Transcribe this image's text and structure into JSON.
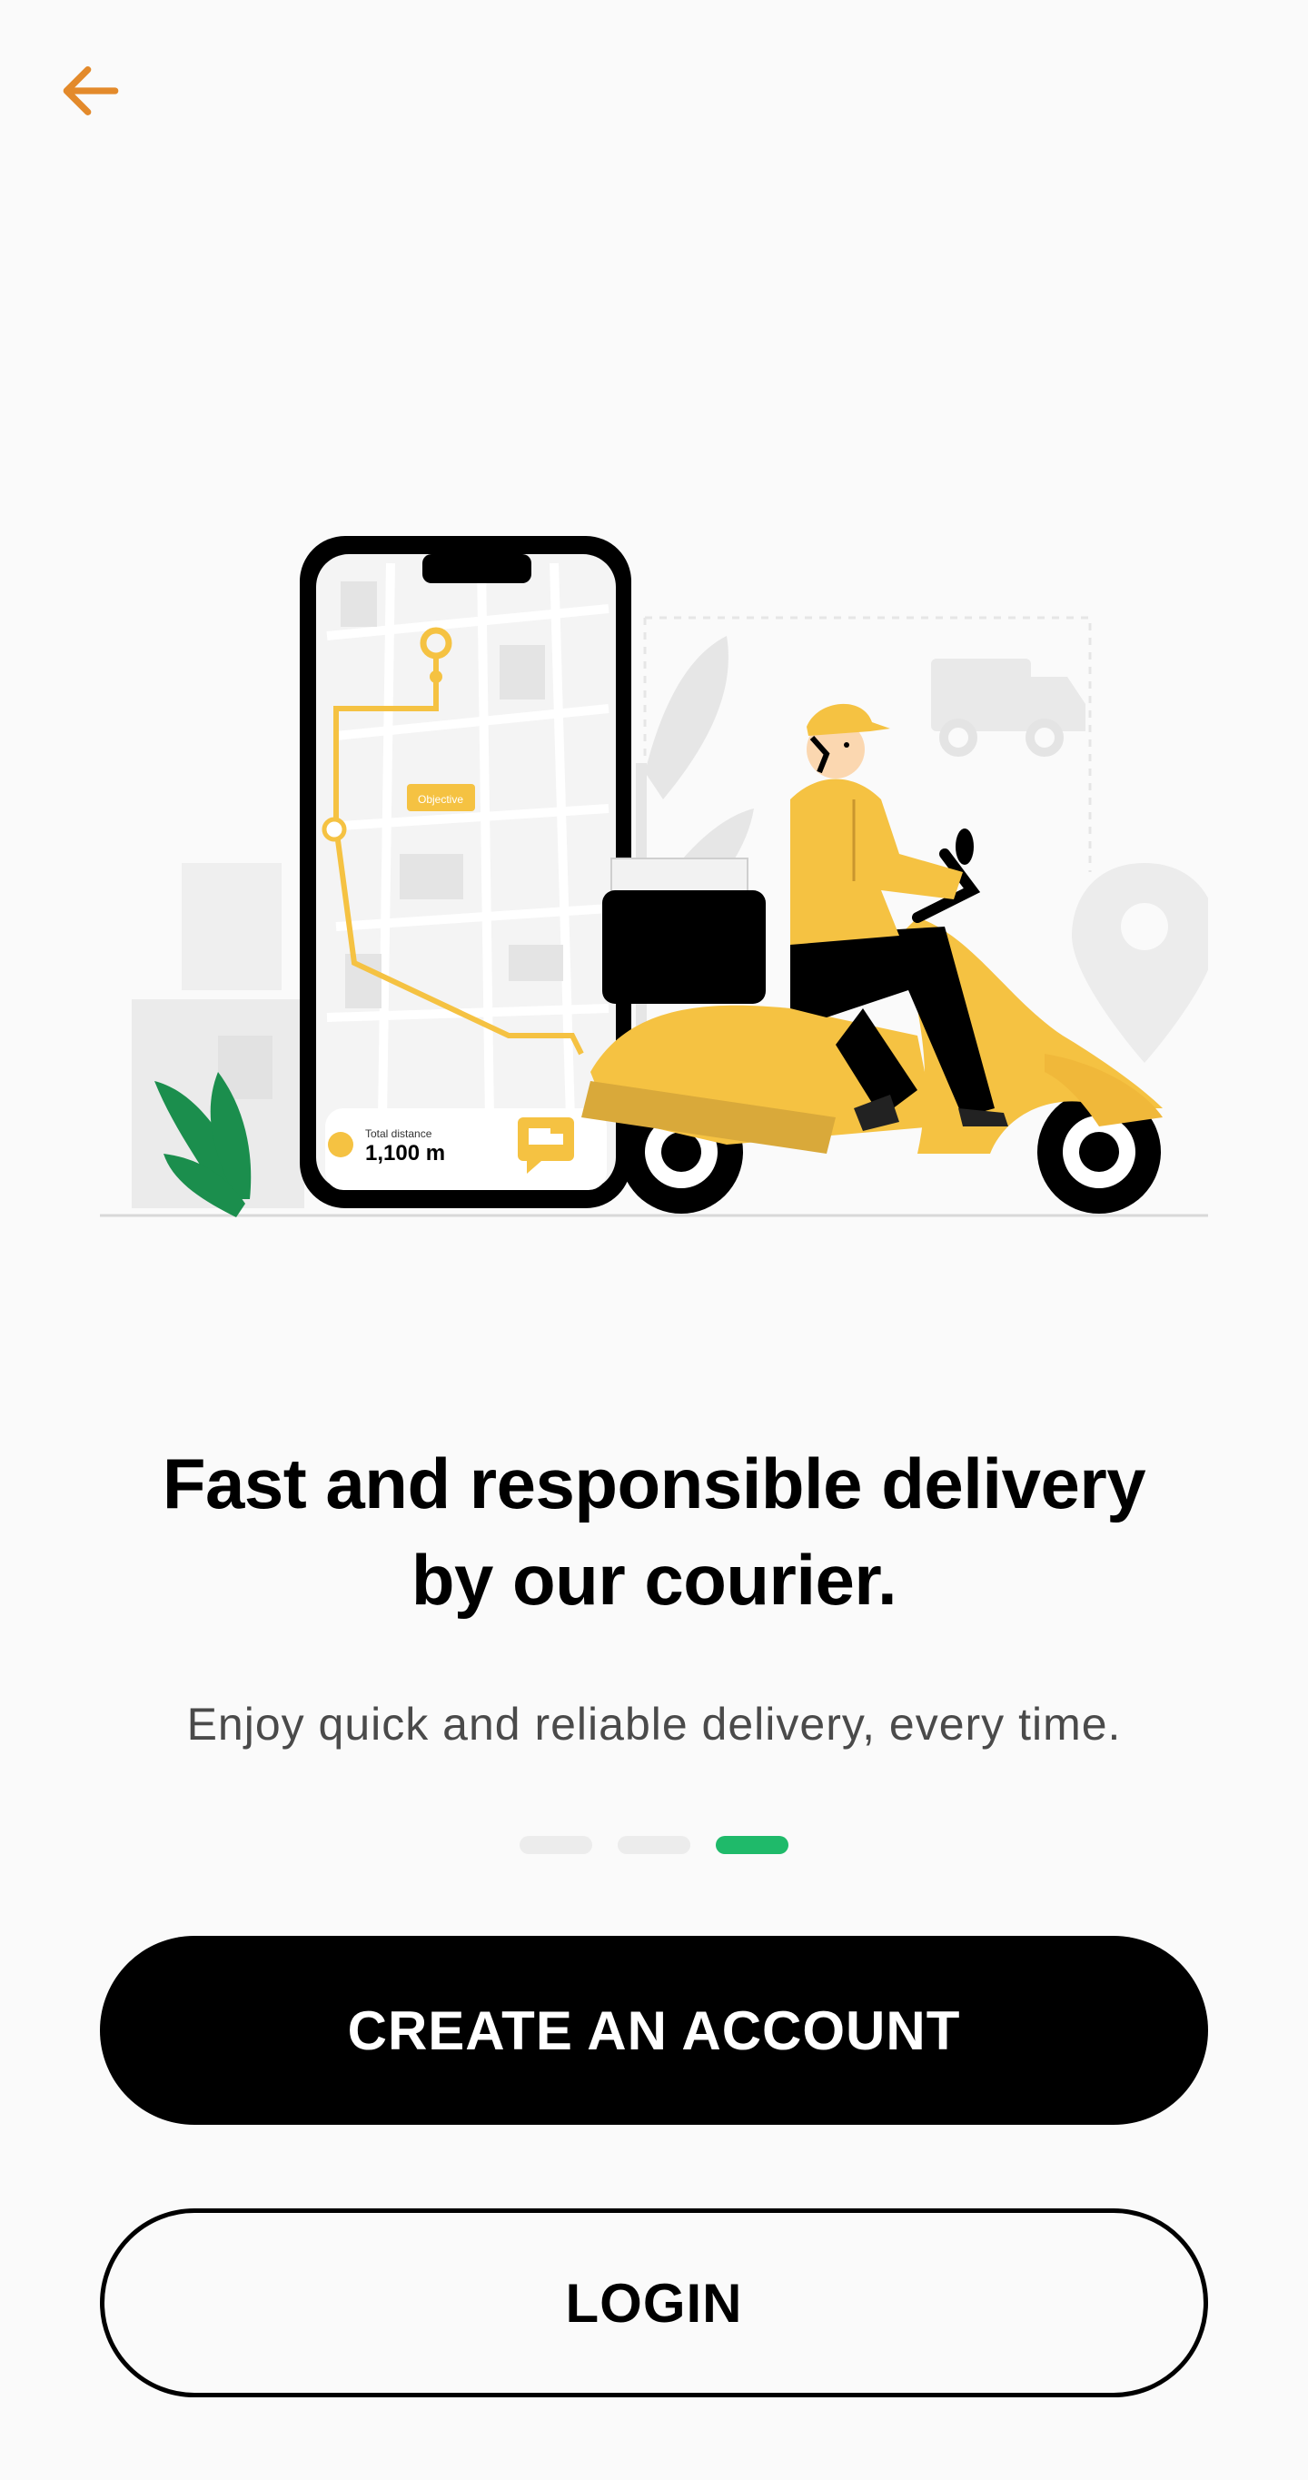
{
  "header": {
    "back_icon": "arrow-left-icon",
    "accent_color": "#e38a2b"
  },
  "illustration": {
    "phone_card": {
      "label": "Total distance",
      "value": "1,100 m",
      "pin_label": "Objective"
    }
  },
  "onboarding": {
    "title_line1": "Fast and responsible delivery",
    "title_line2": "by our courier.",
    "subtitle": "Enjoy quick and reliable delivery, every time.",
    "pager": {
      "total": 3,
      "active_index": 2,
      "active_color": "#1fba6a"
    }
  },
  "actions": {
    "create_account_label": "CREATE AN ACCOUNT",
    "login_label": "LOGIN"
  }
}
